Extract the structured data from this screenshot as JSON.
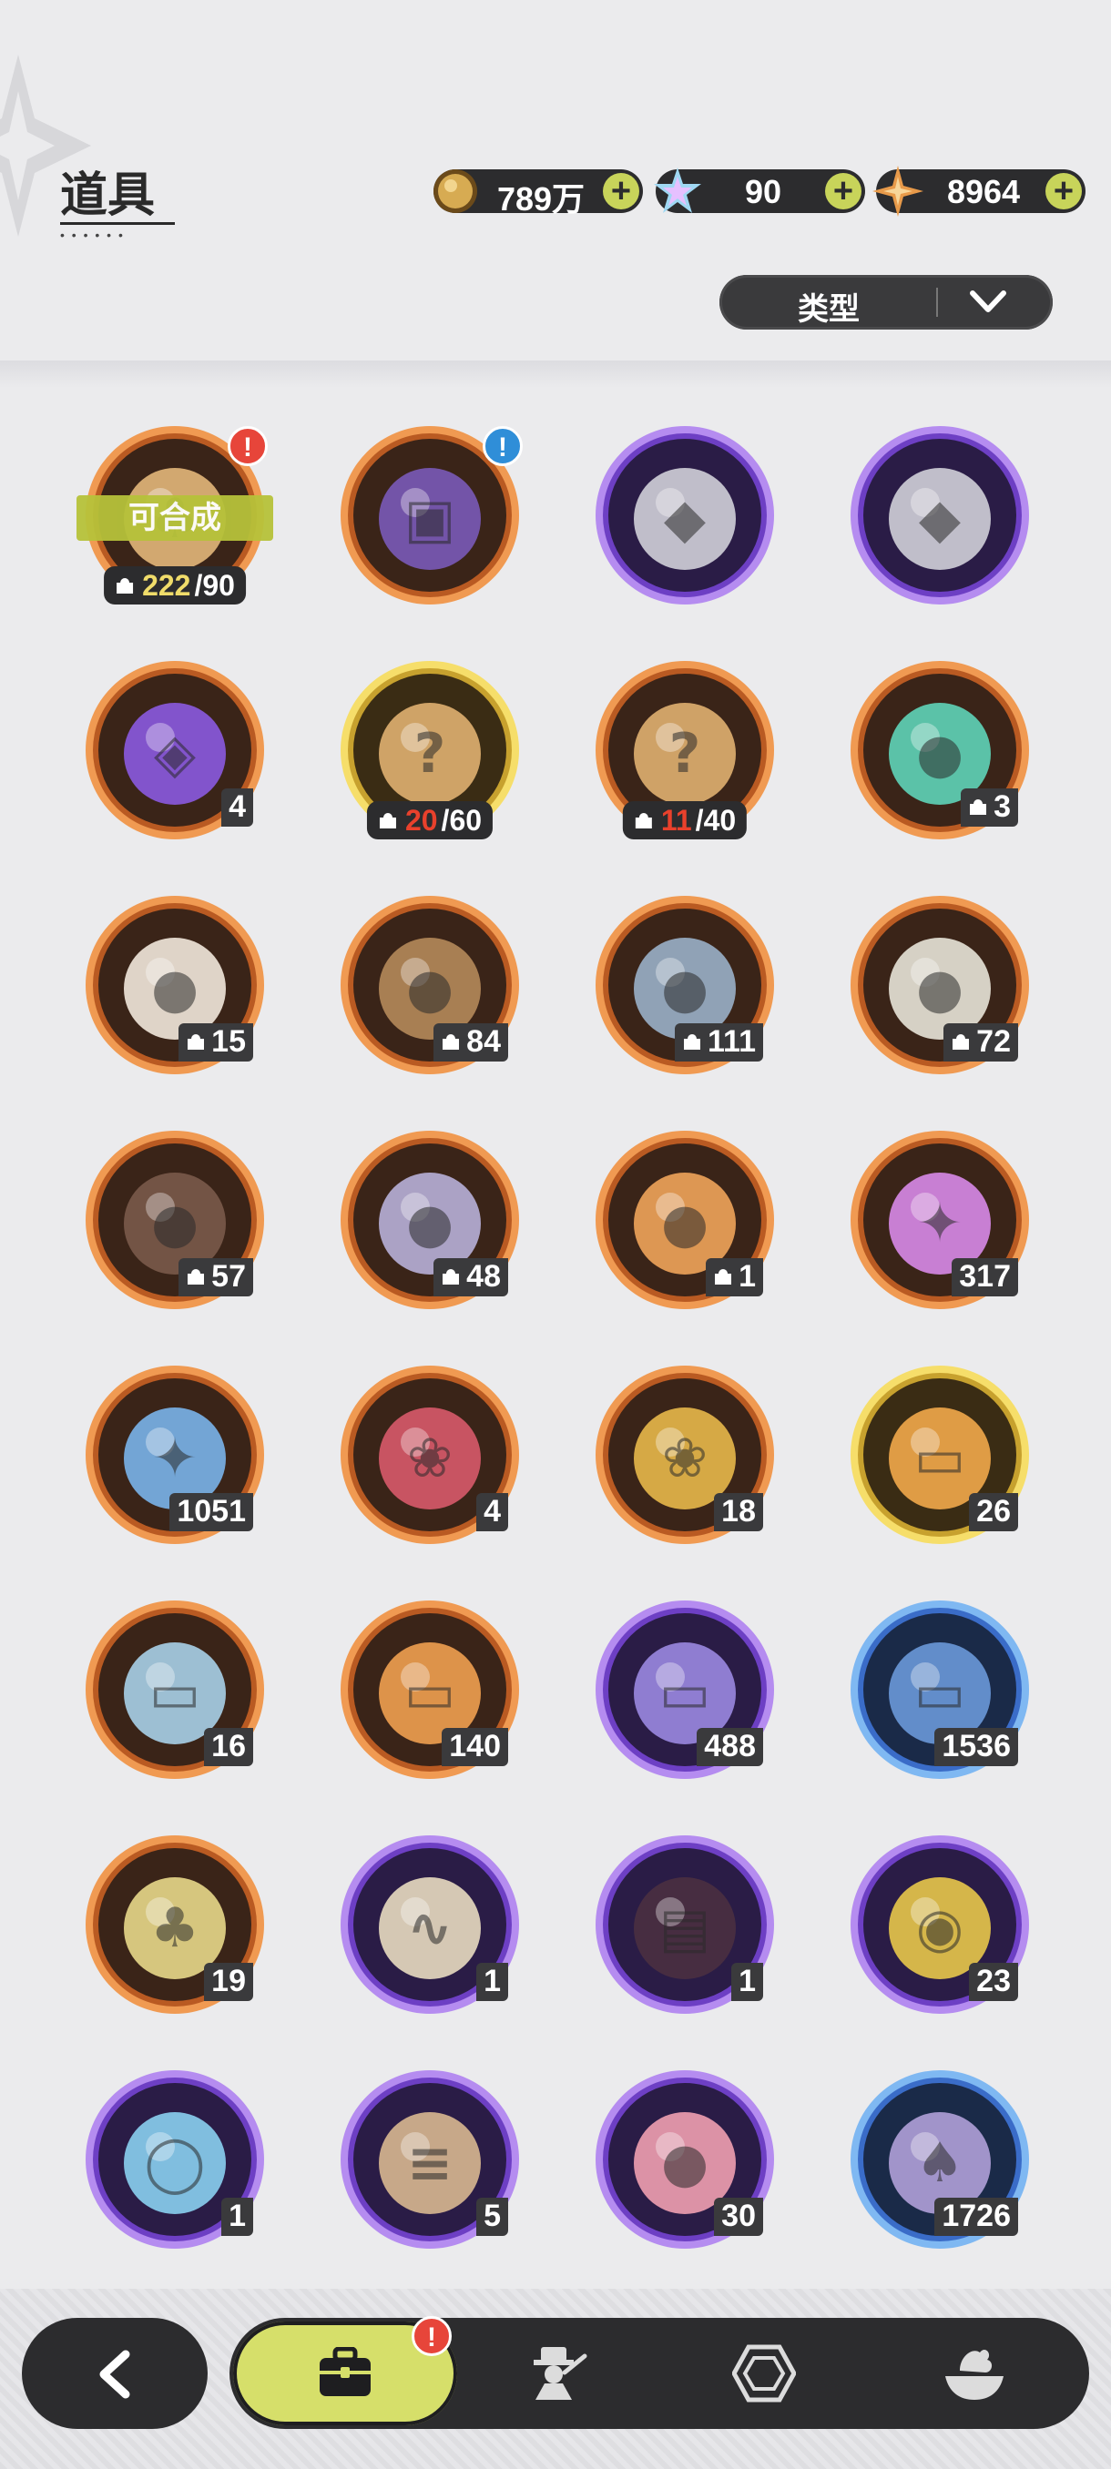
{
  "header": {
    "title": "道具",
    "filter_label": "类型"
  },
  "currencies": [
    {
      "icon": "gold-coin-icon",
      "value": "789万",
      "color": "#d6a54a"
    },
    {
      "icon": "crystal-star-icon",
      "value": "90",
      "color": "#7fc6ea"
    },
    {
      "icon": "orange-star-icon",
      "value": "8964",
      "color": "#e89a4a"
    }
  ],
  "items": [
    {
      "id": "r1c1",
      "ring": "orange",
      "icon": "puzzle-animal-icon",
      "tag": "可合成",
      "frac_have": "222",
      "frac_need": "/90",
      "have_color": "yellow",
      "alert": "!",
      "alert_color": "red"
    },
    {
      "id": "r1c2",
      "ring": "orange",
      "icon": "treasure-chest-icon",
      "alert": "!",
      "alert_color": "blue"
    },
    {
      "id": "r1c3",
      "ring": "purple",
      "icon": "gift-egg-icon"
    },
    {
      "id": "r1c4",
      "ring": "purple",
      "icon": "gift-egg-icon"
    },
    {
      "id": "r2c1",
      "ring": "orange",
      "icon": "purple-card-icon",
      "qty": "4"
    },
    {
      "id": "r2c2",
      "ring": "gold",
      "icon": "mystery-shard-icon",
      "frac_have": "20",
      "frac_need": "/60",
      "have_color": "red"
    },
    {
      "id": "r2c3",
      "ring": "orange",
      "icon": "mystery-shard-icon",
      "frac_have": "11",
      "frac_need": "/40",
      "have_color": "red"
    },
    {
      "id": "r2c4",
      "ring": "orange",
      "icon": "teal-bird-shard-icon",
      "qty": "3",
      "shard": true
    },
    {
      "id": "r3c1",
      "ring": "orange",
      "icon": "cat-shard-icon",
      "qty": "15",
      "shard": true
    },
    {
      "id": "r3c2",
      "ring": "orange",
      "icon": "bear-shard-icon",
      "qty": "84",
      "shard": true
    },
    {
      "id": "r3c3",
      "ring": "orange",
      "icon": "knight-shard-icon",
      "qty": "111",
      "shard": true
    },
    {
      "id": "r3c4",
      "ring": "orange",
      "icon": "tiger-shard-icon",
      "qty": "72",
      "shard": true
    },
    {
      "id": "r4c1",
      "ring": "orange",
      "icon": "dark-bear-shard-icon",
      "qty": "57",
      "shard": true
    },
    {
      "id": "r4c2",
      "ring": "orange",
      "icon": "raccoon-shard-icon",
      "qty": "48",
      "shard": true
    },
    {
      "id": "r4c3",
      "ring": "orange",
      "icon": "orange-cat-shard-icon",
      "qty": "1",
      "shard": true
    },
    {
      "id": "r4c4",
      "ring": "orange",
      "icon": "pink-crystal-icon",
      "qty": "317"
    },
    {
      "id": "r5c1",
      "ring": "orange",
      "icon": "blue-crystal-icon",
      "qty": "1051"
    },
    {
      "id": "r5c2",
      "ring": "orange",
      "icon": "red-paw-charm-icon",
      "qty": "4"
    },
    {
      "id": "r5c3",
      "ring": "orange",
      "icon": "gold-paw-charm-icon",
      "qty": "18"
    },
    {
      "id": "r5c4",
      "ring": "gold",
      "icon": "gold-portrait-card-icon",
      "qty": "26"
    },
    {
      "id": "r6c1",
      "ring": "orange",
      "icon": "rainbow-portrait-card-icon",
      "qty": "16"
    },
    {
      "id": "r6c2",
      "ring": "orange",
      "icon": "orange-portrait-card-icon",
      "qty": "140"
    },
    {
      "id": "r6c3",
      "ring": "purple",
      "icon": "purple-portrait-card-icon",
      "qty": "488"
    },
    {
      "id": "r6c4",
      "ring": "blue",
      "icon": "blue-portrait-card-icon",
      "qty": "1536"
    },
    {
      "id": "r7c1",
      "ring": "orange",
      "icon": "clover-card-icon",
      "qty": "19"
    },
    {
      "id": "r7c2",
      "ring": "purple",
      "icon": "horn-ornament-icon",
      "qty": "1"
    },
    {
      "id": "r7c3",
      "ring": "purple",
      "icon": "chocolate-gift-icon",
      "qty": "1"
    },
    {
      "id": "r7c4",
      "ring": "purple",
      "icon": "golden-bell-icon",
      "qty": "23"
    },
    {
      "id": "r8c1",
      "ring": "purple",
      "icon": "magic-mirror-icon",
      "qty": "1"
    },
    {
      "id": "r8c2",
      "ring": "purple",
      "icon": "scroll-icon",
      "qty": "5"
    },
    {
      "id": "r8c3",
      "ring": "purple",
      "icon": "pink-apple-icon",
      "qty": "30"
    },
    {
      "id": "r8c4",
      "ring": "blue",
      "icon": "shovel-icon",
      "qty": "1726"
    }
  ],
  "nav": {
    "back_icon": "chevron-left-icon",
    "tabs": [
      {
        "icon": "backpack-icon",
        "active": true,
        "alert": "!"
      },
      {
        "icon": "character-icon",
        "active": false
      },
      {
        "icon": "hexagon-gem-icon",
        "active": false
      },
      {
        "icon": "dessert-icon",
        "active": false
      }
    ]
  }
}
